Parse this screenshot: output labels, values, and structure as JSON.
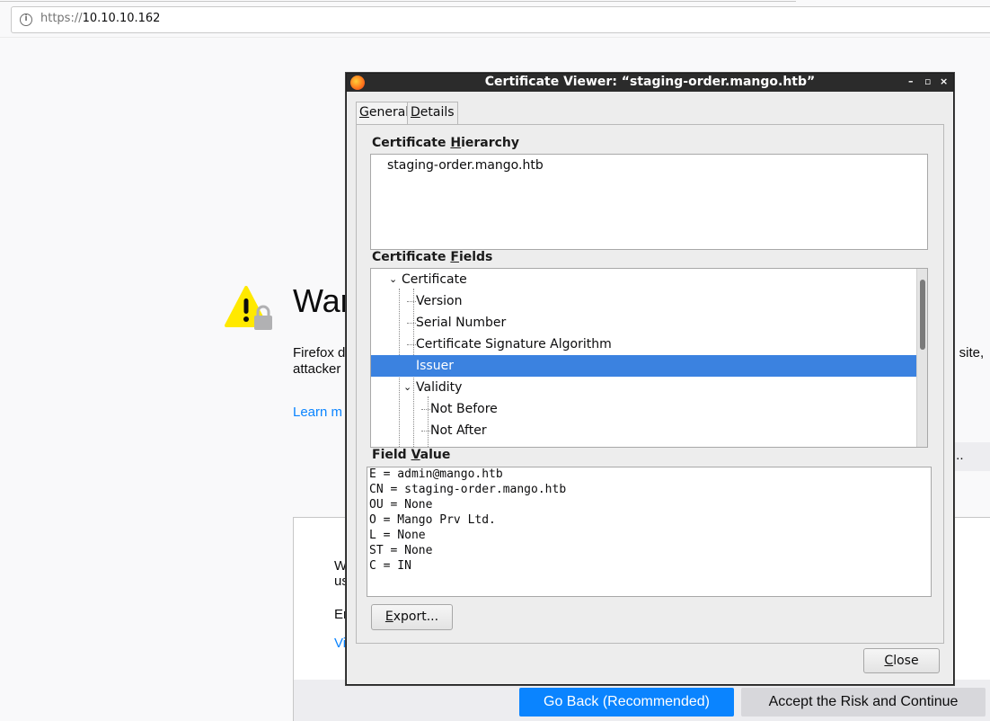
{
  "browser": {
    "url_scheme": "https://",
    "url_host": "10.10.10.162"
  },
  "warning_page": {
    "title_visible": "War",
    "desc_line1_visible": "Firefox d",
    "desc_line2_visible": "attacker",
    "desc_right_visible": "s site,",
    "learn_more_visible": "Learn m",
    "advanced_visible": "...",
    "adv_line1_visible": "W",
    "adv_line2_visible": "us",
    "adv_line3_visible": "Er",
    "adv_link_visible": "Vi",
    "go_back_label": "Go Back (Recommended)",
    "accept_label": "Accept the Risk and Continue"
  },
  "dialog": {
    "title": "Certificate Viewer: “staging-order.mango.htb”",
    "window_buttons": [
      "–",
      "▫",
      "×"
    ],
    "tabs": [
      {
        "label_pre": "",
        "label_key": "G",
        "label_post": "eneral",
        "active": false
      },
      {
        "label_pre": "",
        "label_key": "D",
        "label_post": "etails",
        "active": true
      }
    ],
    "hierarchy_label": {
      "pre": "Certificate ",
      "key": "H",
      "post": "ierarchy"
    },
    "hierarchy_items": [
      "staging-order.mango.htb"
    ],
    "fields_label": {
      "pre": "Certificate ",
      "key": "F",
      "post": "ields"
    },
    "tree_rows": [
      {
        "label": "Certificate",
        "twisty": "⌄"
      },
      {
        "label": "Version"
      },
      {
        "label": "Serial Number"
      },
      {
        "label": "Certificate Signature Algorithm"
      },
      {
        "label": "Issuer",
        "selected": true
      },
      {
        "label": "Validity",
        "twisty": "⌄"
      },
      {
        "label": "Not Before"
      },
      {
        "label": "Not After"
      }
    ],
    "value_label": {
      "pre": "Field ",
      "key": "V",
      "post": "alue"
    },
    "field_value_lines": [
      "E = admin@mango.htb",
      "CN = staging-order.mango.htb",
      "OU = None",
      "O = Mango Prv Ltd.",
      "L = None",
      "ST = None",
      "C = IN"
    ],
    "export_label": {
      "pre": "",
      "key": "E",
      "post": "xport..."
    },
    "close_label": {
      "pre": "",
      "key": "C",
      "post": "lose"
    }
  }
}
